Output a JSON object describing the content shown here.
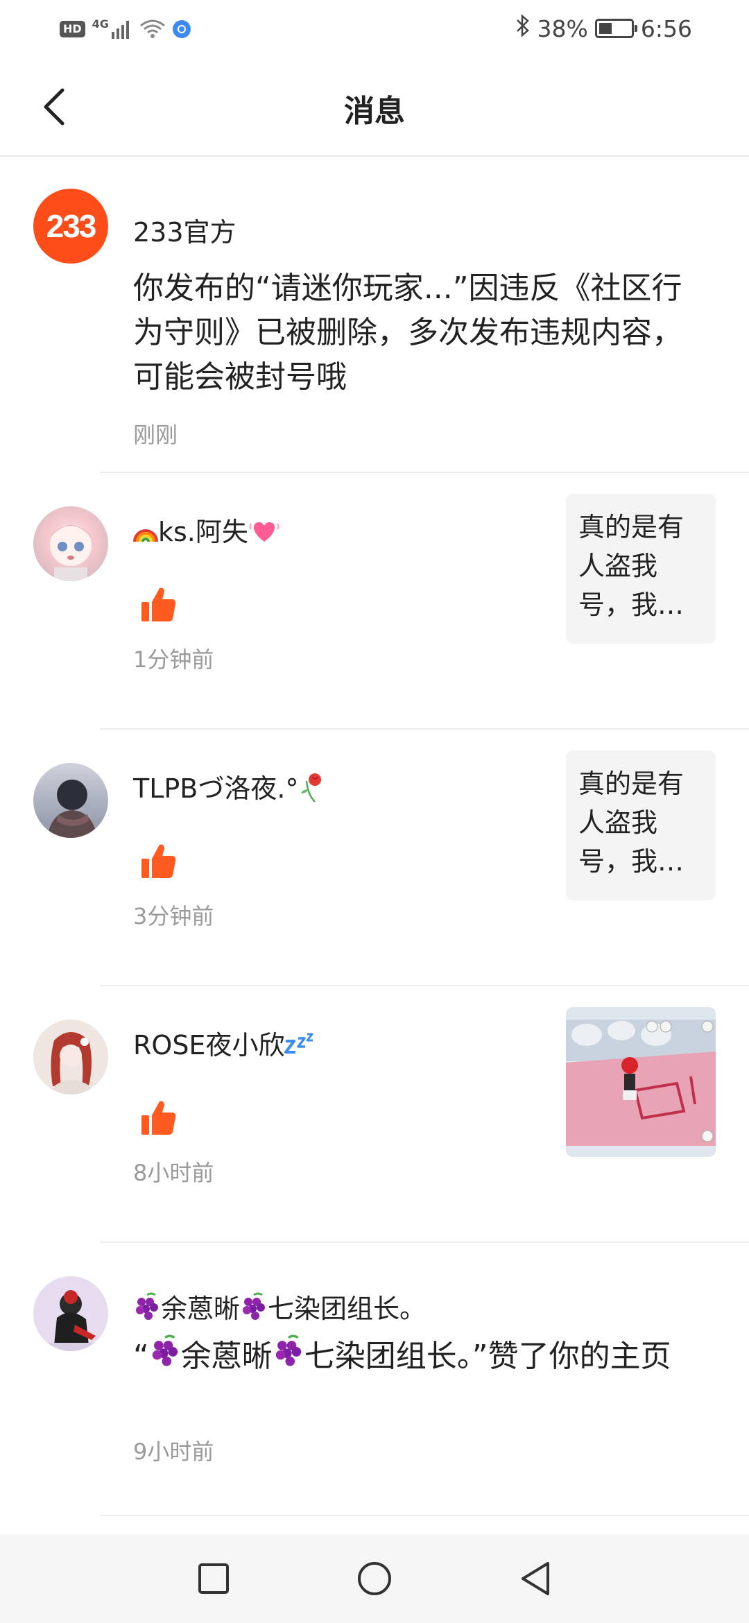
{
  "status_bar": {
    "hd": "HD",
    "network": "4G",
    "battery_percent": "38%",
    "time": "6:56"
  },
  "header": {
    "title": "消息"
  },
  "colors": {
    "accent_orange": "#ff5a1f",
    "divider": "#ececec",
    "time_gray": "#9a9a9a"
  },
  "messages": [
    {
      "name": "233官方",
      "avatar_text": "233",
      "text": "你发布的“请迷你玩家...”因违反《社区行为守则》已被删除，多次发布违规内容，可能会被封号哦",
      "time": "刚刚"
    },
    {
      "name": "ks.阿失",
      "name_prefix_icon": "rainbow-emoji",
      "name_suffix_icon": "pink-heart-emoji",
      "action_icon": "thumbs-up-icon",
      "time": "1分钟前",
      "preview_text": "真的是有人盗我号，我…"
    },
    {
      "name": "TLPBづ洛夜.°",
      "name_suffix_icon": "wilted-rose-emoji",
      "action_icon": "thumbs-up-icon",
      "time": "3分钟前",
      "preview_text": "真的是有人盗我号，我…"
    },
    {
      "name": "ROSE夜小欣",
      "name_suffix_icon": "zzz-emoji",
      "action_icon": "thumbs-up-icon",
      "time": "8小时前",
      "preview_image": "game-screenshot-thumbnail"
    },
    {
      "name_parts": [
        "余蒽晰",
        "七染团组长。"
      ],
      "name_icon": "grapes-emoji",
      "text_parts": [
        "“",
        "余蒽晰",
        "七染团组长。”赞了你的主页"
      ],
      "time": "9小时前"
    }
  ],
  "nav_bar": {
    "icons": [
      "recents-square-icon",
      "home-circle-icon",
      "back-triangle-icon"
    ]
  }
}
